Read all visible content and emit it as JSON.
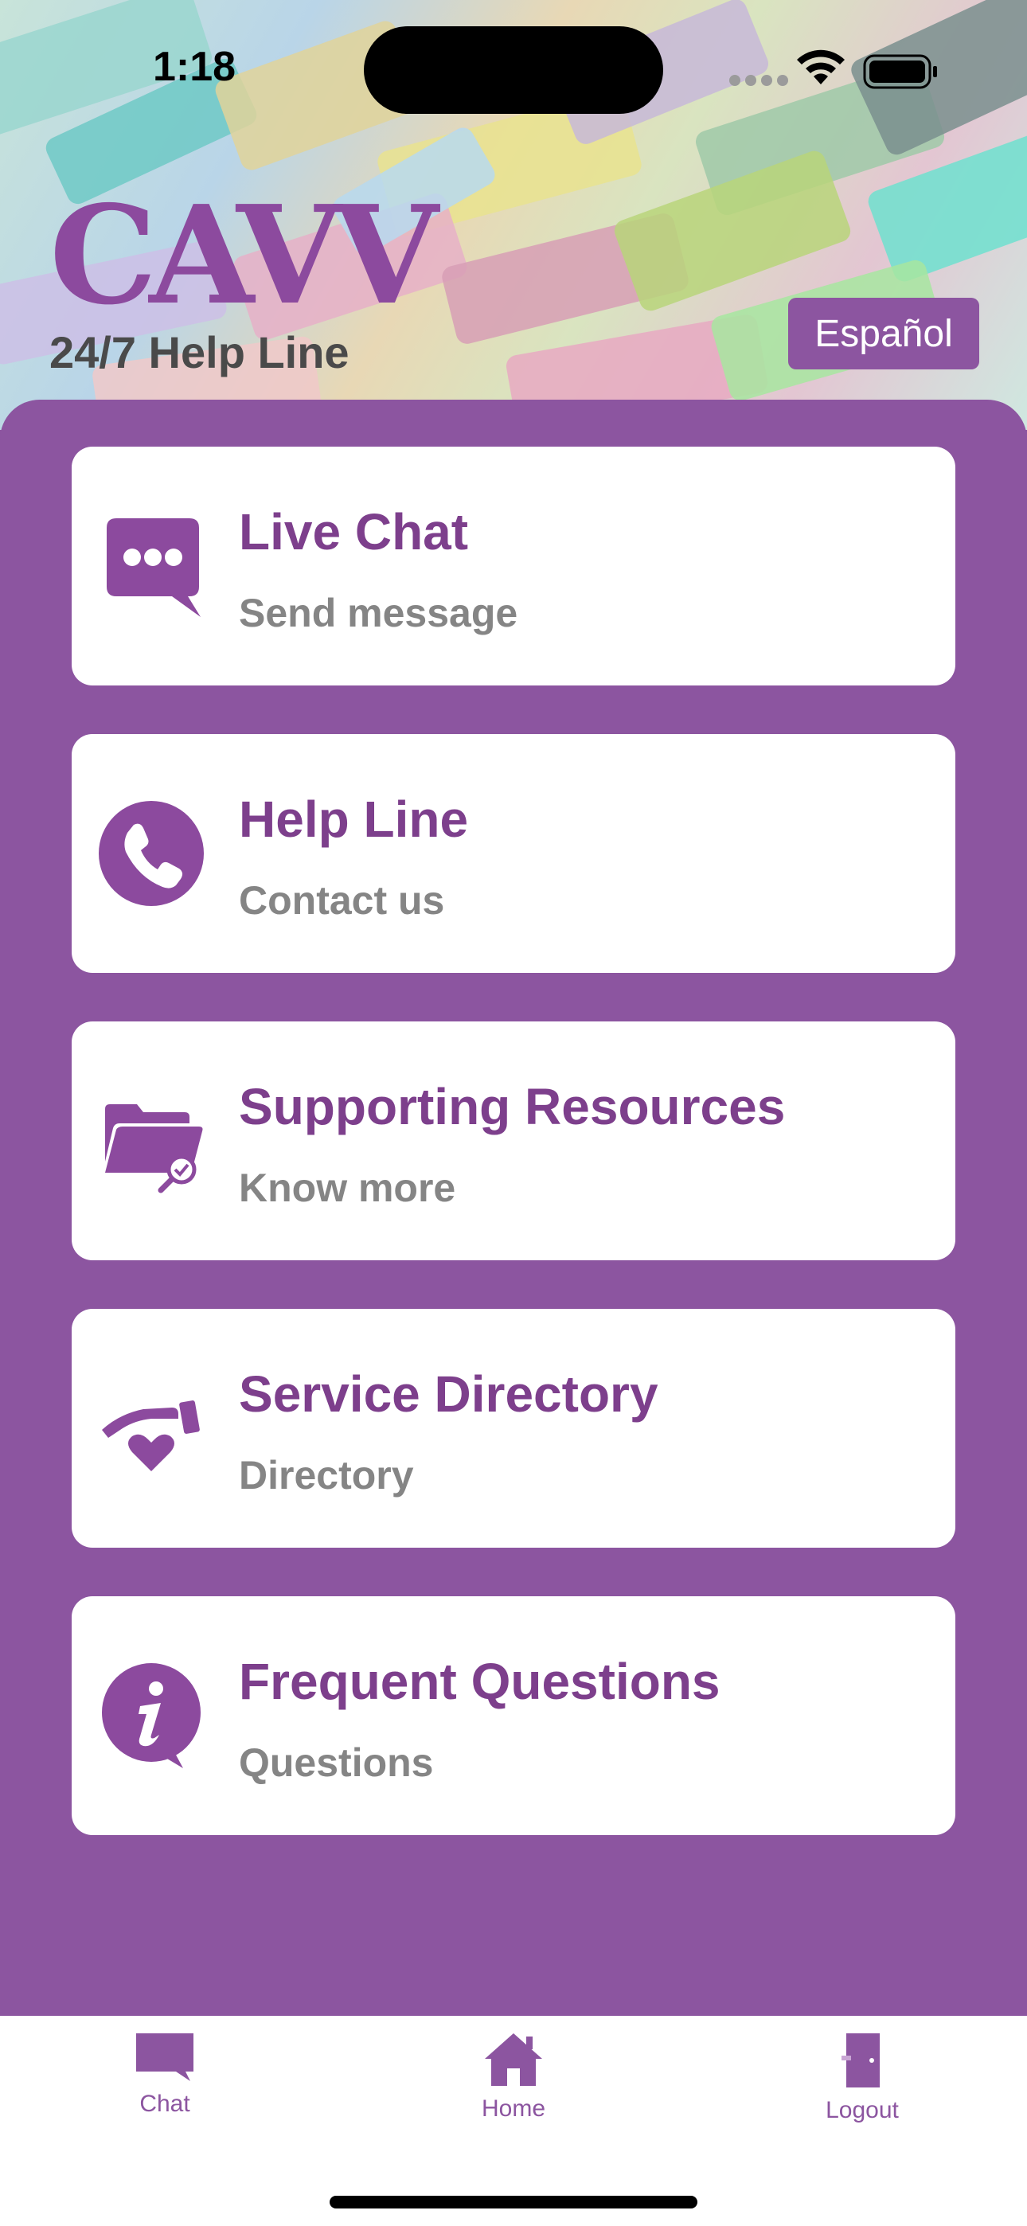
{
  "status_bar": {
    "time": "1:18"
  },
  "header": {
    "logo_text": "CAVV",
    "subtitle": "24/7 Help Line",
    "language_button": "Español"
  },
  "cards": [
    {
      "title": "Live Chat",
      "subtitle": "Send message",
      "icon": "chat-bubble-icon"
    },
    {
      "title": "Help Line",
      "subtitle": "Contact us",
      "icon": "phone-icon"
    },
    {
      "title": "Supporting Resources",
      "subtitle": "Know more",
      "icon": "folder-search-icon"
    },
    {
      "title": "Service Directory",
      "subtitle": "Directory",
      "icon": "hand-heart-icon"
    },
    {
      "title": "Frequent Questions",
      "subtitle": "Questions",
      "icon": "info-icon"
    }
  ],
  "tab_bar": {
    "items": [
      {
        "label": "Chat",
        "icon": "chat-icon"
      },
      {
        "label": "Home",
        "icon": "home-icon"
      },
      {
        "label": "Logout",
        "icon": "door-icon"
      }
    ]
  },
  "colors": {
    "brand_purple": "#8c55a0",
    "title_purple": "#7d3f8c",
    "subtitle_gray": "#858585"
  }
}
